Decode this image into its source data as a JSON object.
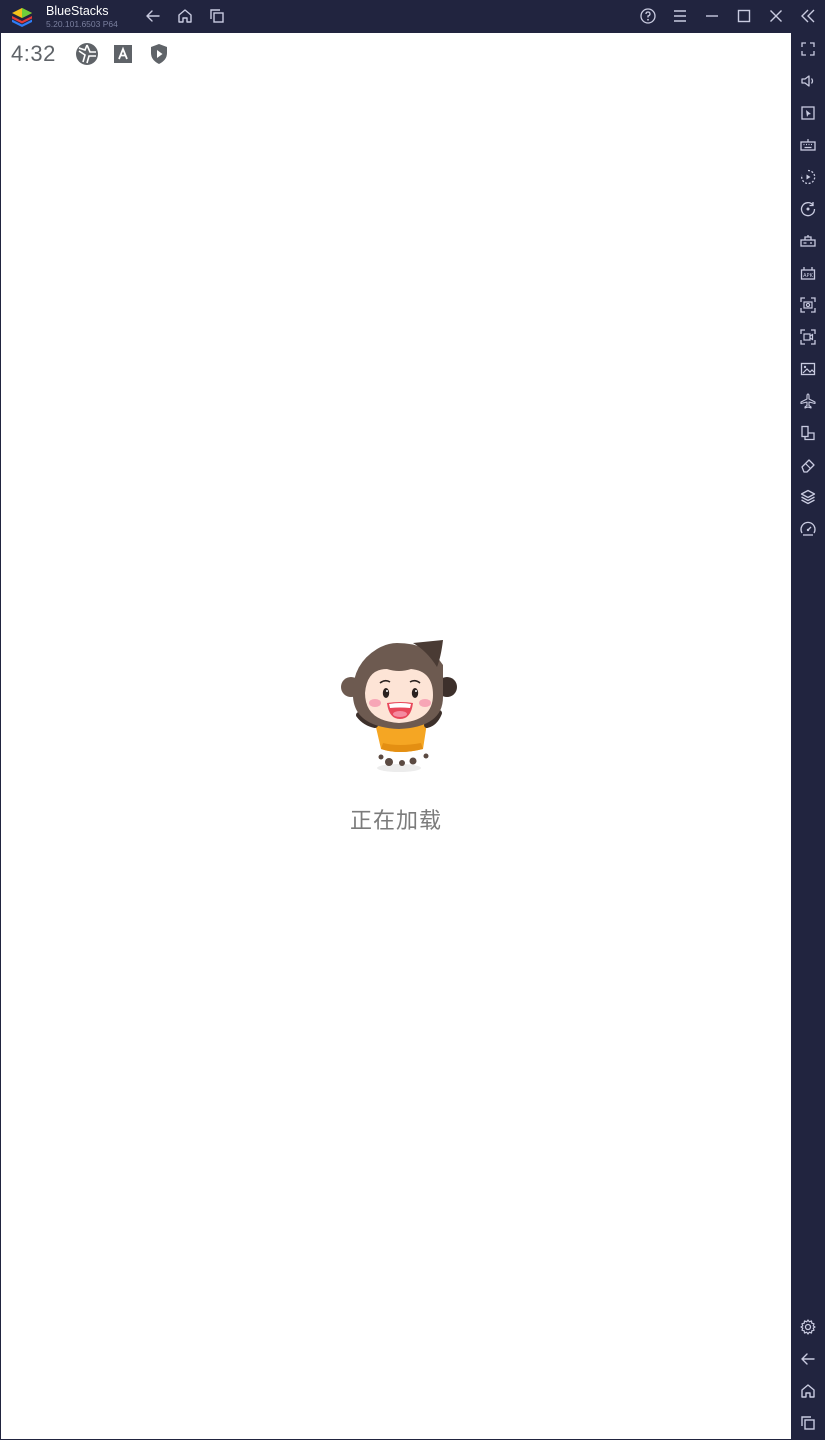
{
  "window": {
    "app_name": "BlueStacks",
    "version": "5.20.101.6503  P64"
  },
  "titlebar": {
    "left_icons": [
      "back-arrow-icon",
      "home-icon",
      "recent-apps-icon"
    ],
    "right_icons": [
      "help-icon",
      "menu-icon",
      "minimize-icon",
      "maximize-icon",
      "close-icon",
      "collapse-sidebar-icon"
    ]
  },
  "android": {
    "status_time": "4:32",
    "status_icons": [
      "aperture-icon",
      "font-a-icon",
      "shield-play-icon"
    ],
    "loading_text": "正在加载"
  },
  "sidebar": {
    "top_icons": [
      "fullscreen-icon",
      "volume-icon",
      "cursor-icon",
      "keyboard-icon",
      "macro-play-icon",
      "rotate-icon",
      "gamepad-icon",
      "apk-install-icon",
      "screenshot-icon",
      "screen-record-icon",
      "media-folder-icon",
      "airplane-mode-icon",
      "multi-instance-icon",
      "erase-icon",
      "layers-icon",
      "performance-icon"
    ],
    "bottom_icons": [
      "settings-gear-icon",
      "android-back-icon",
      "android-home-icon",
      "android-recents-icon"
    ]
  },
  "colors": {
    "chrome": "#21243f",
    "screen": "#ffffff",
    "icon": "#c9cbe0",
    "status_text": "#5f6368",
    "loading_text": "#7b7b7b"
  }
}
